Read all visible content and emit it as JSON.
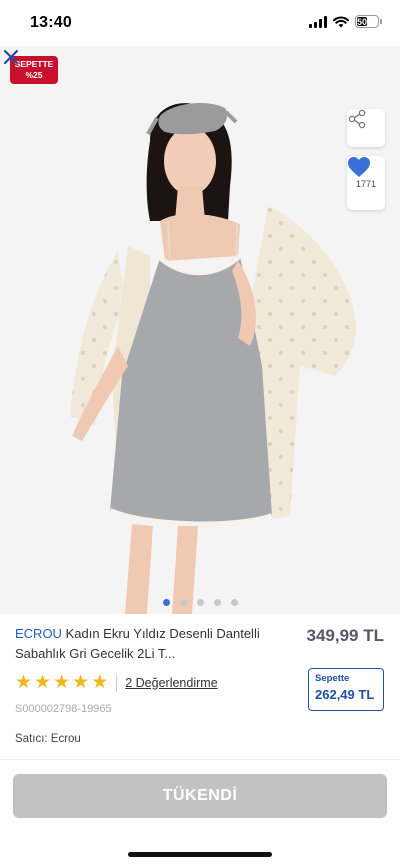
{
  "status_bar": {
    "time": "13:40",
    "battery": "50"
  },
  "hero": {
    "badge_line1": "SEPETTE",
    "badge_line2": "%25",
    "favorite_count": "1771",
    "carousel": {
      "count": 5,
      "active_index": 0
    }
  },
  "product": {
    "brand": "ECROU",
    "title": "Kadın Ekru Yıldız Desenli Dantelli Sabahlık Gri Gecelik 2Li T...",
    "price": "349,99 TL",
    "rating": 5,
    "reviews_link": "2 Değerlendirme",
    "cart_label": "Sepette",
    "cart_price": "262,49 TL",
    "sku": "S000002798-19965",
    "seller": "Satıcı: Ecrou"
  },
  "actions": {
    "sold_out_label": "TÜKENDİ"
  },
  "colors": {
    "accent": "#1f5fbf",
    "badge": "#c8102e",
    "star": "#f3b61f",
    "favorite": "#3a6fd8",
    "disabled_button": "#c2c2c2"
  },
  "icons": [
    "signal-icon",
    "wifi-icon",
    "battery-icon",
    "close-icon",
    "share-icon",
    "heart-icon",
    "star-icon"
  ]
}
